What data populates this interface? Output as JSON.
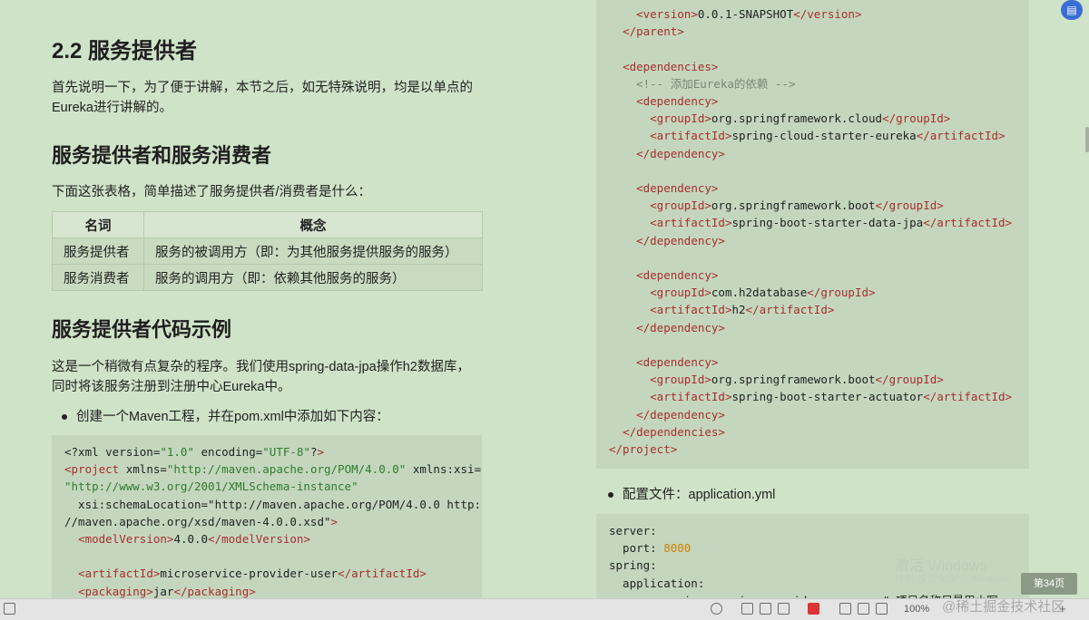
{
  "left": {
    "heading_main": "2.2 服务提供者",
    "intro": "首先说明一下，为了便于讲解，本节之后，如无特殊说明，均是以单点的Eureka进行讲解的。",
    "heading_provider_consumer": "服务提供者和服务消费者",
    "table_intro": "下面这张表格，简单描述了服务提供者/消费者是什么：",
    "table": {
      "headers": [
        "名词",
        "概念"
      ],
      "rows": [
        [
          "服务提供者",
          "服务的被调用方（即：为其他服务提供服务的服务）"
        ],
        [
          "服务消费者",
          "服务的调用方（即：依赖其他服务的服务）"
        ]
      ]
    },
    "heading_code_example": "服务提供者代码示例",
    "program_desc": "这是一个稍微有点复杂的程序。我们使用spring-data-jpa操作h2数据库，同时将该服务注册到注册中心Eureka中。",
    "bullet_maven": "创建一个Maven工程，并在pom.xml中添加如下内容："
  },
  "code_left": [
    "<?xml version=\"1.0\" encoding=\"UTF-8\"?>",
    "<project xmlns=\"http://maven.apache.org/POM/4.0.0\" xmlns:xsi=",
    "\"http://www.w3.org/2001/XMLSchema-instance\"",
    "  xsi:schemaLocation=\"http://maven.apache.org/POM/4.0.0 http:",
    "//maven.apache.org/xsd/maven-4.0.0.xsd\">",
    "  <modelVersion>4.0.0</modelVersion>",
    "",
    "  <artifactId>microservice-provider-user</artifactId>",
    "  <packaging>jar</packaging>"
  ],
  "code_right": [
    "    <version>0.0.1-SNAPSHOT</version>",
    "  </parent>",
    "",
    "  <dependencies>",
    "    <!-- 添加Eureka的依赖 -->",
    "    <dependency>",
    "      <groupId>org.springframework.cloud</groupId>",
    "      <artifactId>spring-cloud-starter-eureka</artifactId>",
    "    </dependency>",
    "",
    "    <dependency>",
    "      <groupId>org.springframework.boot</groupId>",
    "      <artifactId>spring-boot-starter-data-jpa</artifactId>",
    "    </dependency>",
    "",
    "    <dependency>",
    "      <groupId>com.h2database</groupId>",
    "      <artifactId>h2</artifactId>",
    "    </dependency>",
    "",
    "    <dependency>",
    "      <groupId>org.springframework.boot</groupId>",
    "      <artifactId>spring-boot-starter-actuator</artifactId>",
    "    </dependency>",
    "  </dependencies>",
    "</project>"
  ],
  "right": {
    "bullet_config": "配置文件：application.yml"
  },
  "code_yml": [
    "server:",
    "  port: 8000",
    "spring:",
    "  application:",
    "    name: microservice-provider-user    # 项目名称尽量用小写"
  ],
  "overlay": {
    "page_badge": "第34页",
    "watermark_title": "激活 Windows",
    "watermark_sub": "转到\"设置\"以激活 Windows",
    "zoom": "100%",
    "jj_watermark": "@稀土掘金技术社区"
  },
  "colors": {
    "page_bg": "#cfe3c8",
    "code_bg": "#c4d7be",
    "tag": "#a82d2d",
    "string": "#2e7a2e"
  }
}
